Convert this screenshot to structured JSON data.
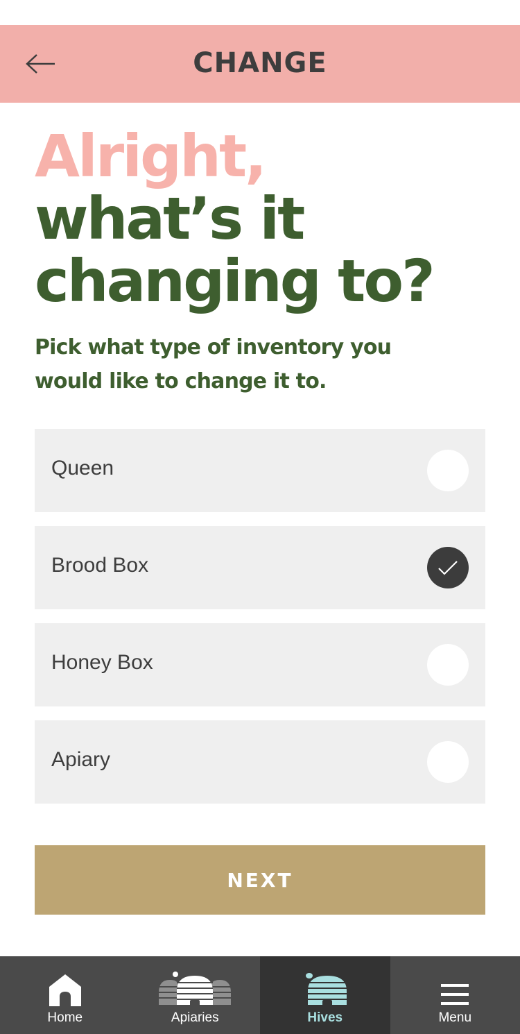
{
  "header": {
    "title": "CHANGE",
    "back_icon": "arrow-left-icon",
    "background": "#f2afaa"
  },
  "heading": {
    "accent": "Alright,",
    "line2": "what’s it",
    "line3": "changing to?"
  },
  "subheading": {
    "line1": "Pick what type of inventory you",
    "line2": "would like to change it to."
  },
  "options": [
    {
      "label": "Queen",
      "selected": false
    },
    {
      "label": "Brood Box",
      "selected": true
    },
    {
      "label": "Honey Box",
      "selected": false
    },
    {
      "label": "Apiary",
      "selected": false
    }
  ],
  "next_button": {
    "label": "NEXT",
    "color": "#bda573"
  },
  "tabbar": {
    "tabs": [
      {
        "label": "Home",
        "icon": "home-icon",
        "active": false
      },
      {
        "label": "Apiaries",
        "icon": "apiaries-icon",
        "active": false
      },
      {
        "label": "Hives",
        "icon": "hive-icon",
        "active": true
      },
      {
        "label": "Menu",
        "icon": "menu-icon",
        "active": false
      }
    ]
  },
  "colors": {
    "accent_pink": "#f7b2ab",
    "heading_green": "#3e5e2f",
    "tab_active_text": "#a9dfe0"
  }
}
